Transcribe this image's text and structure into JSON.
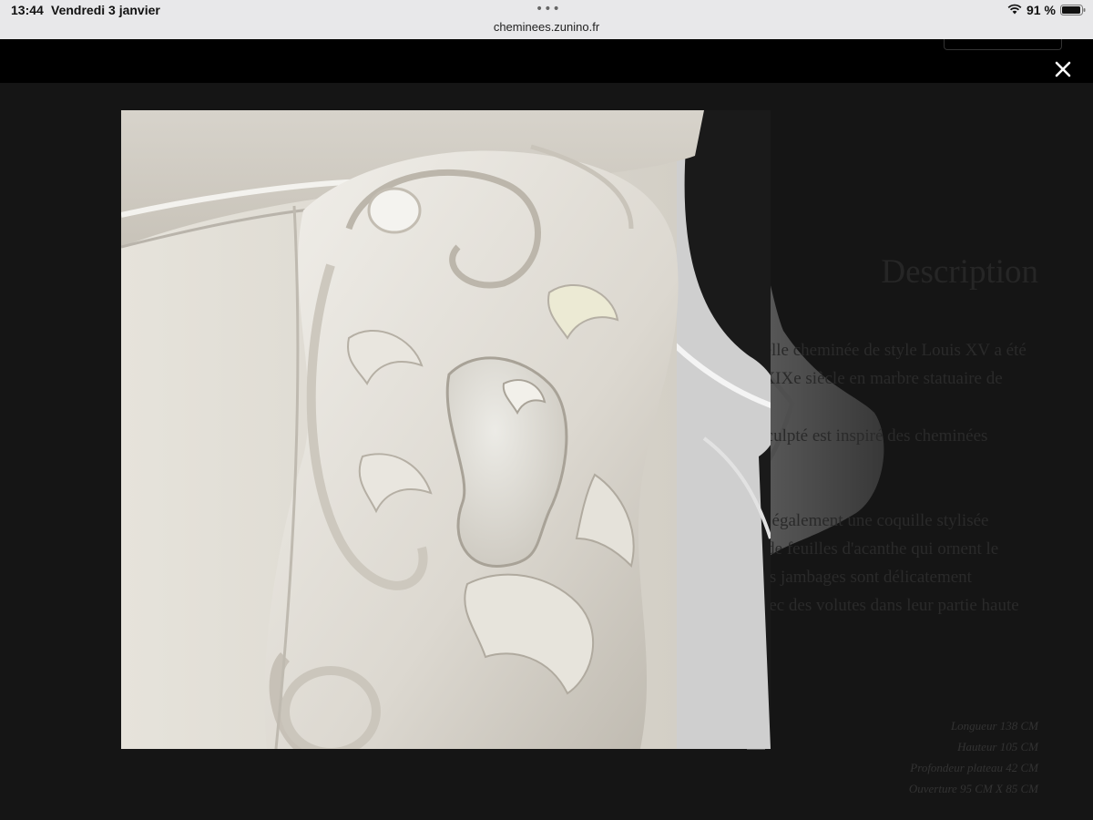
{
  "statusbar": {
    "time": "13:44",
    "date": "Vendredi 3 janvier",
    "dots": "•••",
    "url": "cheminees.zunino.fr",
    "battery_percent": "91 %",
    "icons": {
      "wifi": "wifi-icon",
      "battery": "battery-icon"
    }
  },
  "lightbox": {
    "close_icon": "close-icon",
    "image_alt": "Détail sculpté en marbre blanc d'une cheminée Louis XV"
  },
  "description": {
    "title": "Description",
    "paragraphs": [
      "Cette très belle cheminée de style Louis XV a été réalisée au XIXe siècle en marbre statuaire de Carrare.",
      "Son décor sculpté est inspiré des cheminées Louis XV.",
      "On y trouve également une coquille stylisée environnée de feuilles d'acanthe qui ornent le bandeau. Les jambages sont délicatement travaillés avec des volutes dans leur partie haute et basse."
    ]
  },
  "dimensions": [
    "Longueur 138 CM",
    "Hauteur 105 CM",
    "Profondeur plateau 42 CM",
    "Ouverture 95 CM X 85 CM"
  ],
  "colors": {
    "overlay": "#151515",
    "header": "#000000",
    "statusbar": "#e8e8ea",
    "marble": "#e9e6df"
  }
}
